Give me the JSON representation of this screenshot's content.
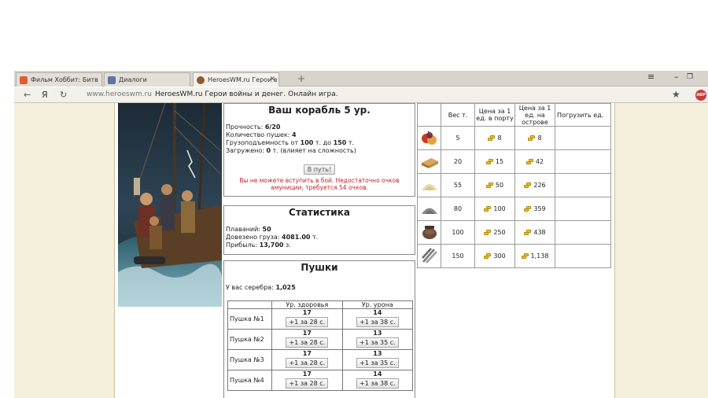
{
  "browser": {
    "tabs": [
      {
        "label": "Фильм Хоббит: Битв",
        "favicon": "vk-icon"
      },
      {
        "label": "Диалоги",
        "favicon": "dialog-icon"
      },
      {
        "label": "HeroesWM.ru Герои в",
        "favicon": "heroes-icon"
      }
    ],
    "new_tab": "+",
    "window_controls": {
      "menu": "≡",
      "minimize": "–",
      "restore": "❐"
    },
    "nav_back": "←",
    "nav_yandex": "Я",
    "nav_reload": "↻",
    "url": "www.heroeswm.ru",
    "page_title": "HeroesWM.ru Герои войны и денег. Онлайн игра.",
    "star": "★",
    "abp": "ABP",
    "extra_menu": "≡"
  },
  "ship": {
    "title": "Ваш корабль 5 ур.",
    "durability_label": "Прочность:",
    "durability_value": "6/20",
    "guns_label": "Количество пушек:",
    "guns_value": "4",
    "capacity_label": "Грузоподъемность от",
    "capacity_from": "100",
    "capacity_mid": "т. до",
    "capacity_to": "150",
    "capacity_unit": "т.",
    "loaded_label": "Загружено:",
    "loaded_value": "0",
    "loaded_suffix": "т. (влияет на сложность)",
    "go_button": "В путь!",
    "error_text": "Вы не можете вступить в бой. Недостаточно очков амуниции, требуется 54 очков."
  },
  "stats": {
    "title": "Статистика",
    "voyages_label": "Плаваний:",
    "voyages_value": "50",
    "cargo_label": "Довезено груза:",
    "cargo_value": "4081.00",
    "cargo_unit": "т.",
    "profit_label": "Прибыль:",
    "profit_value": "13,700",
    "profit_unit": "з."
  },
  "guns": {
    "title": "Пушки",
    "silver_label": "У вас серебра:",
    "silver_value": "1,025",
    "col_health": "Ур. здоровья",
    "col_damage": "Ур. урона",
    "rows": [
      {
        "name": "Пушка №1",
        "health": "17",
        "health_btn": "+1 за 28 с.",
        "damage": "14",
        "damage_btn": "+1 за 38 с."
      },
      {
        "name": "Пушка №2",
        "health": "17",
        "health_btn": "+1 за 28 с.",
        "damage": "13",
        "damage_btn": "+1 за 35 с."
      },
      {
        "name": "Пушка №3",
        "health": "17",
        "health_btn": "+1 за 28 с.",
        "damage": "13",
        "damage_btn": "+1 за 35 с."
      },
      {
        "name": "Пушка №4",
        "health": "17",
        "health_btn": "+1 за 28 с.",
        "damage": "14",
        "damage_btn": "+1 за 38 с."
      }
    ]
  },
  "cargo": {
    "col_weight": "Вес т.",
    "col_port": "Цена за 1 ед. в порту",
    "col_island": "Цена за 1 ед. на острове",
    "col_load": "Погрузить ед.",
    "rows": [
      {
        "icon": "fruit-icon",
        "weight": "5",
        "port": "8",
        "island": "8"
      },
      {
        "icon": "wood-icon",
        "weight": "20",
        "port": "15",
        "island": "42"
      },
      {
        "icon": "sulfur-icon",
        "weight": "55",
        "port": "50",
        "island": "226"
      },
      {
        "icon": "ore-icon",
        "weight": "80",
        "port": "100",
        "island": "359"
      },
      {
        "icon": "pot-icon",
        "weight": "100",
        "port": "250",
        "island": "438"
      },
      {
        "icon": "iron-bars-icon",
        "weight": "150",
        "port": "300",
        "island": "1,138"
      }
    ]
  }
}
